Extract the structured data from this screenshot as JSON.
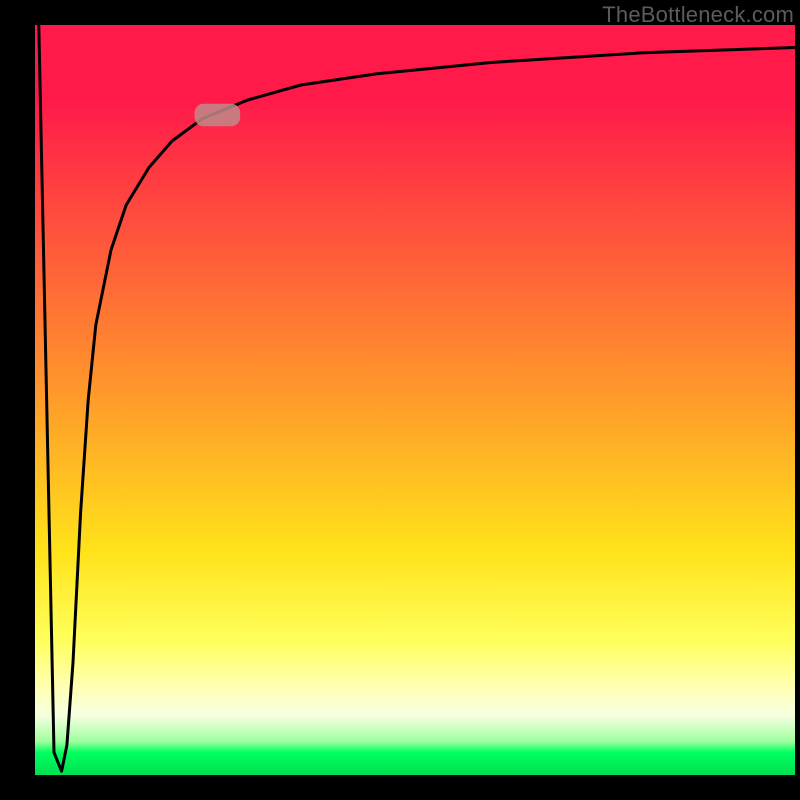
{
  "watermark": "TheBottleneck.com",
  "chart_data": {
    "type": "line",
    "title": "",
    "xlabel": "",
    "ylabel": "",
    "xlim": [
      0,
      100
    ],
    "ylim": [
      0,
      100
    ],
    "legend": false,
    "grid": false,
    "background": "red-yellow-green vertical gradient",
    "series": [
      {
        "name": "bottleneck-curve",
        "x": [
          0.5,
          2.5,
          3.5,
          4.2,
          5.0,
          6.0,
          7.0,
          8.0,
          10.0,
          12.0,
          15.0,
          18.0,
          22.0,
          28.0,
          35.0,
          45.0,
          60.0,
          80.0,
          100.0
        ],
        "y": [
          100.0,
          3.0,
          0.5,
          4.0,
          15.0,
          35.0,
          50.0,
          60.0,
          70.0,
          76.0,
          81.0,
          84.5,
          87.5,
          90.0,
          92.0,
          93.5,
          95.0,
          96.3,
          97.0
        ],
        "color": "#000000",
        "line_width": 3
      }
    ],
    "marker": {
      "x_range": [
        21.0,
        27.0
      ],
      "y_range": [
        86.5,
        89.5
      ],
      "color": "#c08a88",
      "shape": "rounded-rect",
      "opacity": 0.85
    }
  }
}
